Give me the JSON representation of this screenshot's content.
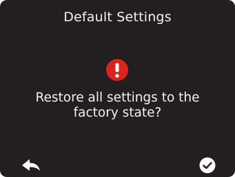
{
  "dialog": {
    "title": "Default Settings",
    "message_line1": "Restore all settings to the",
    "message_line2": "factory state?",
    "warning_icon": "exclamation-circle",
    "back_icon": "back-arrow",
    "confirm_icon": "check-circle"
  },
  "colors": {
    "background": "#231f20",
    "text": "#f2f2f2",
    "warning": "#d9251d"
  }
}
